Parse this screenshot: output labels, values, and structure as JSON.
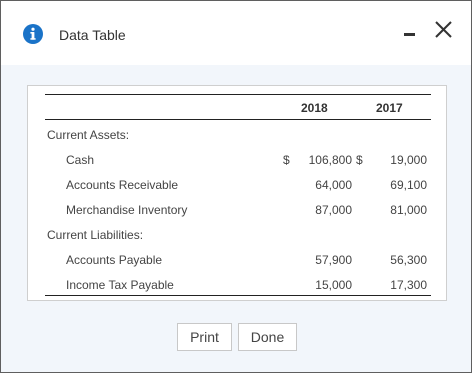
{
  "dialog": {
    "title": "Data Table",
    "icons": {
      "info": "info-icon",
      "minimize": "minimize-icon",
      "close": "close-icon"
    },
    "close_glyph": "✕"
  },
  "table": {
    "columns": [
      "2018",
      "2017"
    ],
    "sections": [
      {
        "label": "Current Assets:",
        "rows": [
          {
            "label": "Cash",
            "prefix_2018": "$",
            "v2018": "106,800",
            "prefix_2017": "$",
            "v2017": "19,000"
          },
          {
            "label": "Accounts Receivable",
            "v2018": "64,000",
            "v2017": "69,100"
          },
          {
            "label": "Merchandise Inventory",
            "v2018": "87,000",
            "v2017": "81,000"
          }
        ]
      },
      {
        "label": "Current Liabilities:",
        "rows": [
          {
            "label": "Accounts Payable",
            "v2018": "57,900",
            "v2017": "56,300"
          },
          {
            "label": "Income Tax Payable",
            "v2018": "15,000",
            "v2017": "17,300"
          }
        ]
      }
    ]
  },
  "buttons": {
    "print": "Print",
    "done": "Done"
  },
  "colors": {
    "info_icon": "#1a73c8",
    "body_bg": "#f2f6fb"
  }
}
